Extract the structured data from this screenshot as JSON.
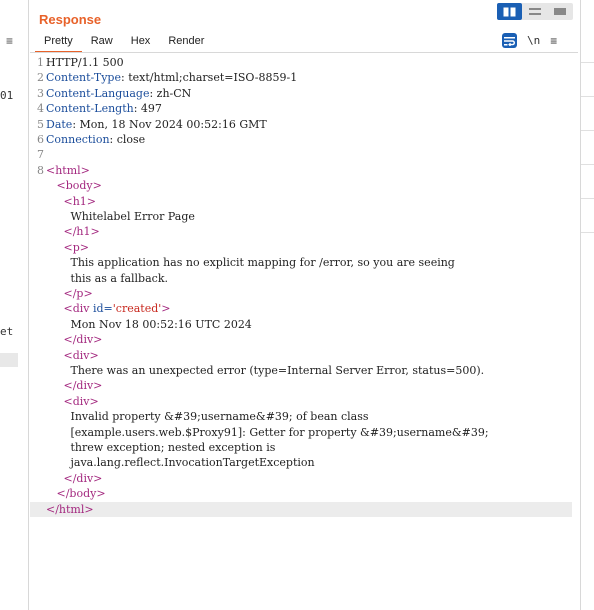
{
  "left_panel": {
    "menu_glyph": "≡",
    "fragments": [
      "01",
      "et"
    ]
  },
  "response": {
    "title": "Response",
    "tabs": [
      {
        "label": "Pretty",
        "active": true
      },
      {
        "label": "Raw",
        "active": false
      },
      {
        "label": "Hex",
        "active": false
      },
      {
        "label": "Render",
        "active": false
      }
    ],
    "toolbar": {
      "newline_label": "\\n",
      "menu_glyph": "≡"
    }
  },
  "editor": {
    "lines": [
      {
        "n": "1",
        "parts": [
          [
            "code",
            "HTTP/1.1 500"
          ]
        ]
      },
      {
        "n": "2",
        "parts": [
          [
            "hn",
            "Content-Type"
          ],
          [
            "code",
            ": text/html;charset=ISO-8859-1"
          ]
        ]
      },
      {
        "n": "3",
        "parts": [
          [
            "hn",
            "Content-Language"
          ],
          [
            "code",
            ": zh-CN"
          ]
        ]
      },
      {
        "n": "4",
        "parts": [
          [
            "hn",
            "Content-Length"
          ],
          [
            "code",
            ": 497"
          ]
        ]
      },
      {
        "n": "5",
        "parts": [
          [
            "hn",
            "Date"
          ],
          [
            "code",
            ": Mon, 18 Nov 2024 00:52:16 GMT"
          ]
        ]
      },
      {
        "n": "6",
        "parts": [
          [
            "hn",
            "Connection"
          ],
          [
            "code",
            ": close"
          ]
        ]
      },
      {
        "n": "7",
        "parts": []
      },
      {
        "n": "8",
        "parts": [
          [
            "tag",
            "<html>"
          ]
        ]
      },
      {
        "n": "",
        "parts": [
          [
            "txt",
            "   "
          ],
          [
            "tag",
            "<body>"
          ]
        ]
      },
      {
        "n": "",
        "parts": [
          [
            "txt",
            "     "
          ],
          [
            "tag",
            "<h1>"
          ]
        ]
      },
      {
        "n": "",
        "parts": [
          [
            "txt",
            "       Whitelabel Error Page"
          ]
        ]
      },
      {
        "n": "",
        "parts": [
          [
            "txt",
            "     "
          ],
          [
            "tag",
            "</h1>"
          ]
        ]
      },
      {
        "n": "",
        "parts": [
          [
            "txt",
            "     "
          ],
          [
            "tag",
            "<p>"
          ]
        ]
      },
      {
        "n": "",
        "parts": [
          [
            "txt",
            "       This application has no explicit mapping for /error, so you are seeing"
          ]
        ]
      },
      {
        "n": "",
        "parts": [
          [
            "txt",
            "       this as a fallback."
          ]
        ]
      },
      {
        "n": "",
        "parts": [
          [
            "txt",
            "     "
          ],
          [
            "tag",
            "</p>"
          ]
        ]
      },
      {
        "n": "",
        "parts": [
          [
            "txt",
            "     "
          ],
          [
            "tag",
            "<div "
          ],
          [
            "attr",
            "id="
          ],
          [
            "str",
            "'created'"
          ],
          [
            "tag",
            ">"
          ]
        ]
      },
      {
        "n": "",
        "parts": [
          [
            "txt",
            "       Mon Nov 18 00:52:16 UTC 2024"
          ]
        ]
      },
      {
        "n": "",
        "parts": [
          [
            "txt",
            "     "
          ],
          [
            "tag",
            "</div>"
          ]
        ]
      },
      {
        "n": "",
        "parts": [
          [
            "txt",
            "     "
          ],
          [
            "tag",
            "<div>"
          ]
        ]
      },
      {
        "n": "",
        "parts": [
          [
            "txt",
            "       There was an unexpected error (type=Internal Server Error, status=500)."
          ]
        ]
      },
      {
        "n": "",
        "parts": [
          [
            "txt",
            "     "
          ],
          [
            "tag",
            "</div>"
          ]
        ]
      },
      {
        "n": "",
        "parts": [
          [
            "txt",
            "     "
          ],
          [
            "tag",
            "<div>"
          ]
        ]
      },
      {
        "n": "",
        "parts": [
          [
            "txt",
            "       Invalid property &#39;username&#39; of bean class"
          ]
        ]
      },
      {
        "n": "",
        "parts": [
          [
            "txt",
            "       [example.users.web.$Proxy91]: Getter for property &#39;username&#39;"
          ]
        ]
      },
      {
        "n": "",
        "parts": [
          [
            "txt",
            "       threw exception; nested exception is"
          ]
        ]
      },
      {
        "n": "",
        "parts": [
          [
            "txt",
            "       java.lang.reflect.InvocationTargetException"
          ]
        ]
      },
      {
        "n": "",
        "parts": [
          [
            "txt",
            "     "
          ],
          [
            "tag",
            "</div>"
          ]
        ]
      },
      {
        "n": "",
        "parts": [
          [
            "txt",
            "   "
          ],
          [
            "tag",
            "</body>"
          ]
        ]
      },
      {
        "n": "",
        "parts": [
          [
            "tag",
            "</html>"
          ]
        ],
        "highlight": true
      }
    ]
  }
}
